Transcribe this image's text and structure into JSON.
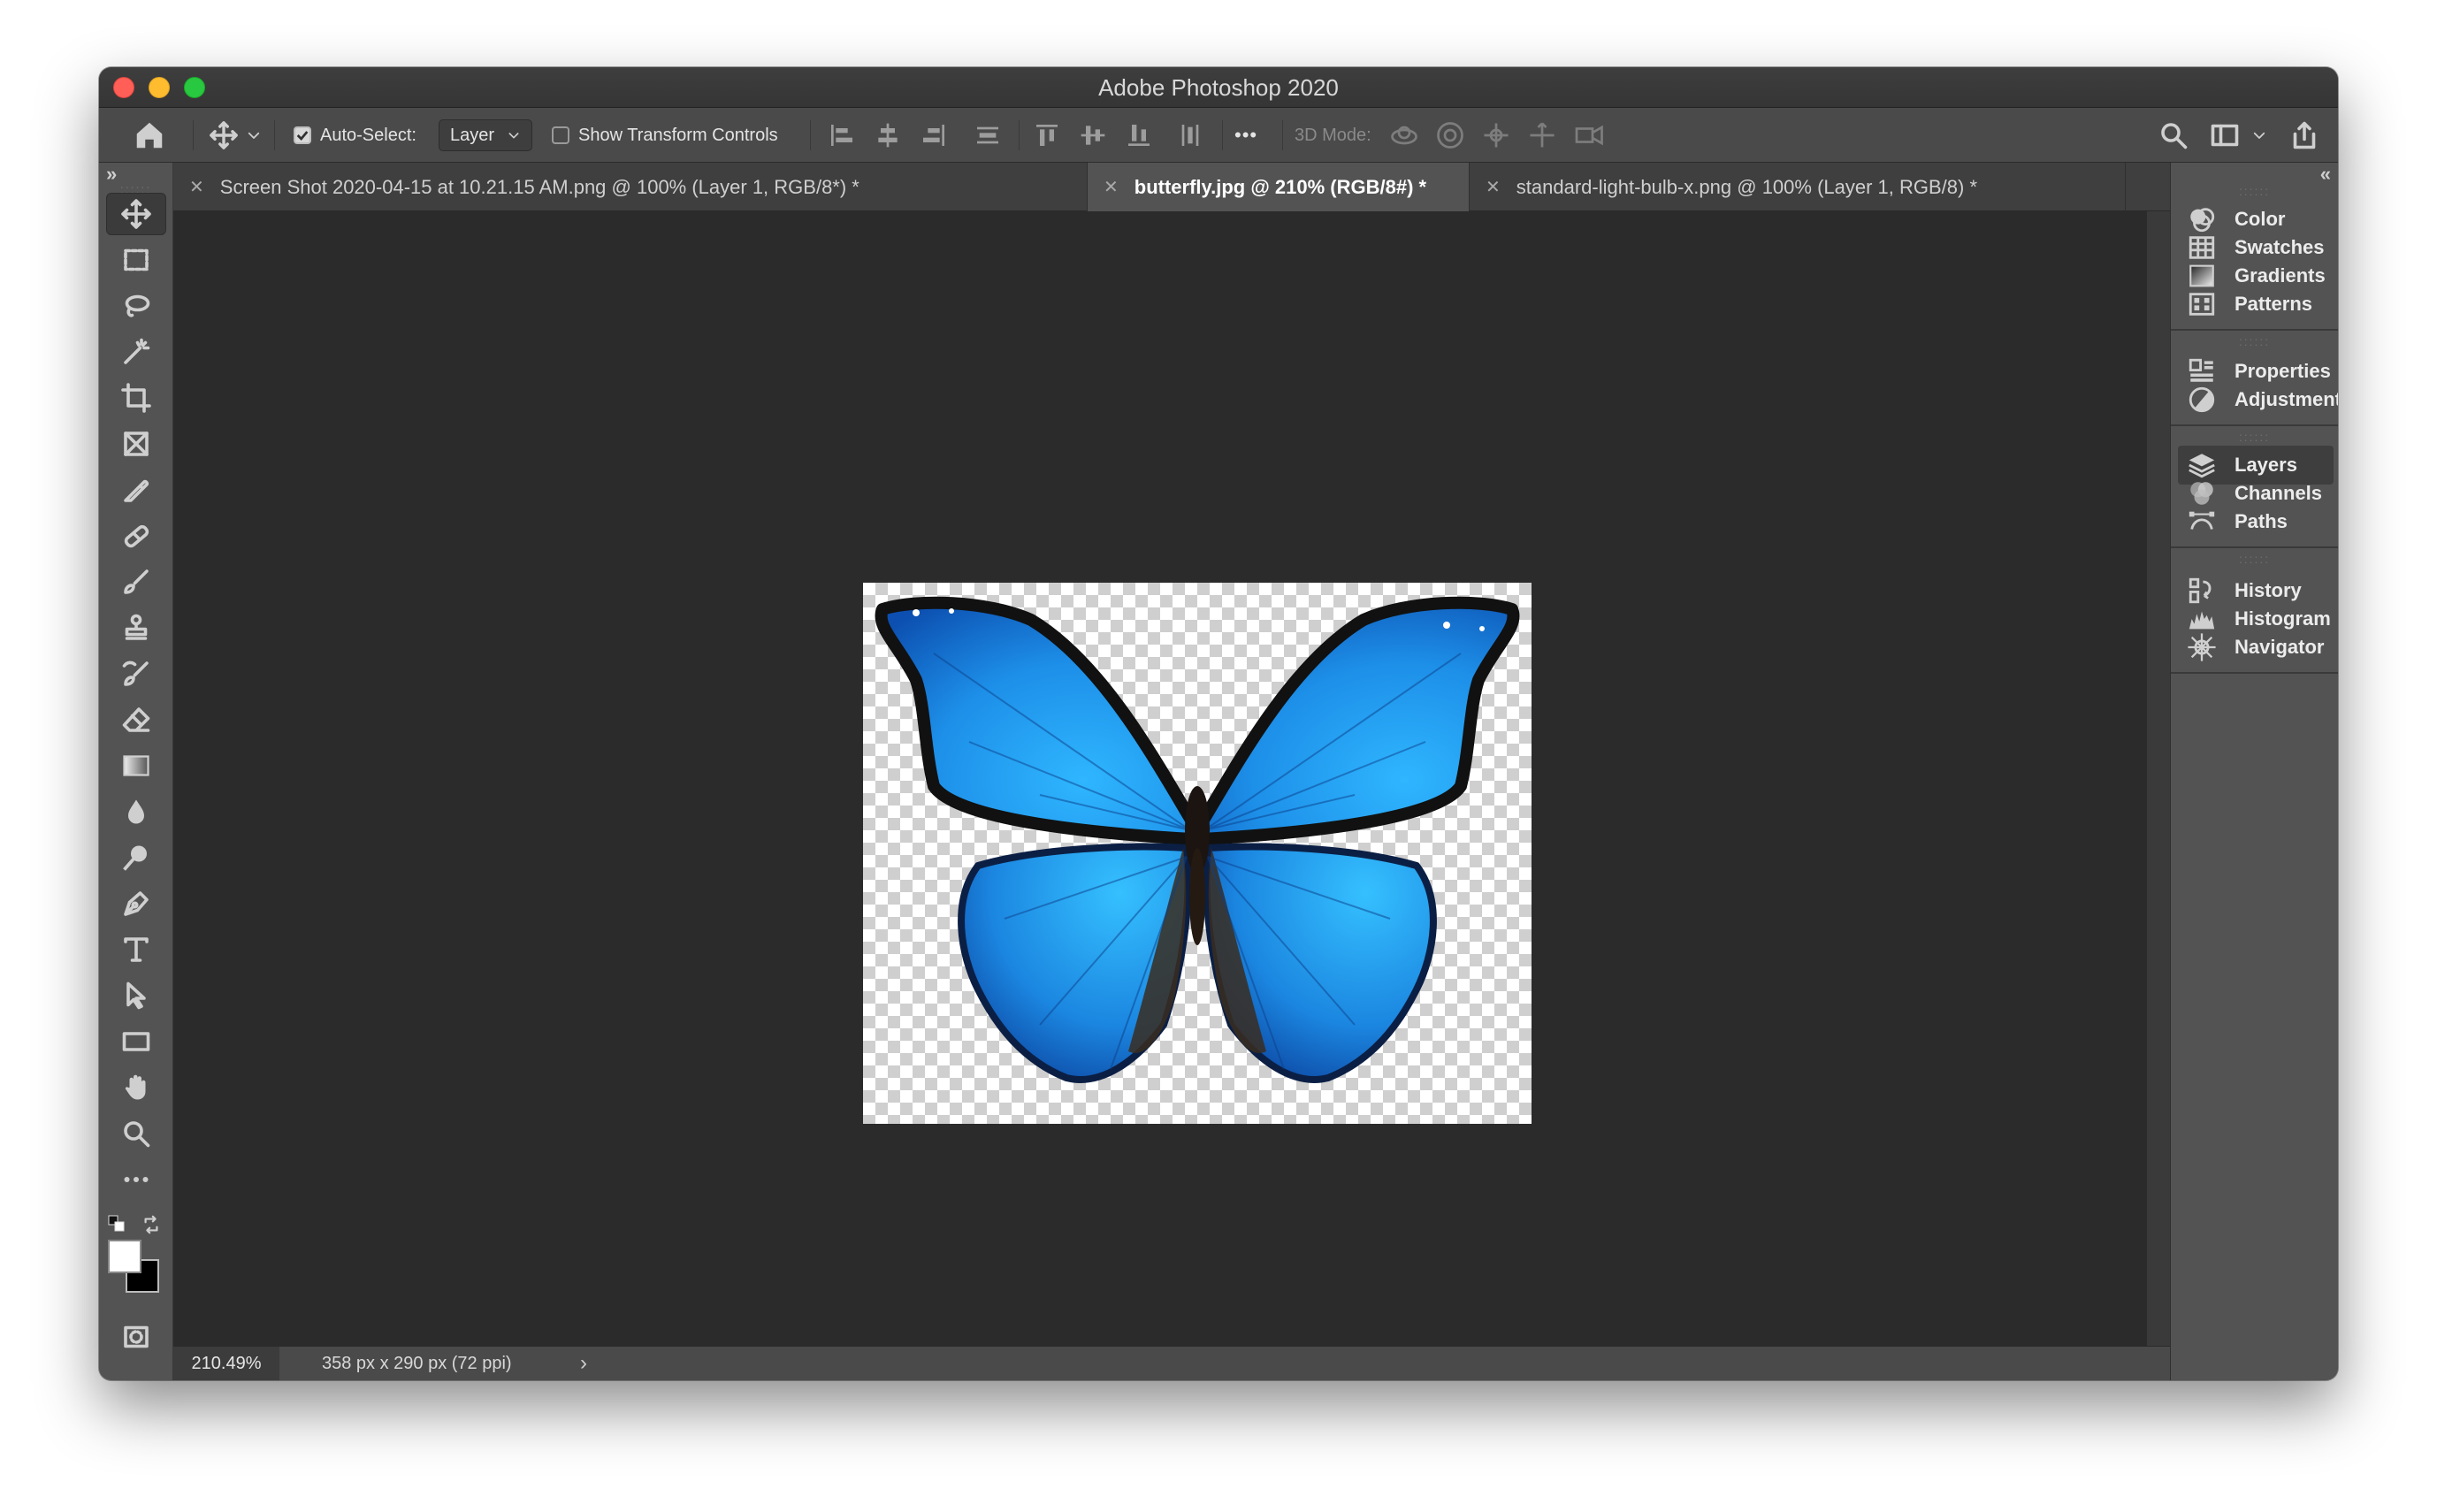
{
  "window": {
    "title": "Adobe Photoshop 2020"
  },
  "options_bar": {
    "auto_select_label": "Auto-Select:",
    "auto_select_checked": true,
    "auto_select_target": "Layer",
    "show_transform_label": "Show Transform Controls",
    "show_transform_checked": false,
    "mode_3d_label": "3D Mode:",
    "more_label": "•••"
  },
  "tabs": [
    {
      "label": "Screen Shot 2020-04-15 at 10.21.15 AM.png @ 100% (Layer 1, RGB/8*) *",
      "active": false
    },
    {
      "label": "butterfly.jpg @ 210% (RGB/8#) *",
      "active": true
    },
    {
      "label": "standard-light-bulb-x.png @ 100% (Layer 1, RGB/8) *",
      "active": false
    }
  ],
  "tools": [
    "move-tool",
    "marquee-tool",
    "lasso-tool",
    "magic-wand-tool",
    "crop-tool",
    "frame-tool",
    "eyedropper-tool",
    "healing-brush-tool",
    "brush-tool",
    "clone-stamp-tool",
    "history-brush-tool",
    "eraser-tool",
    "gradient-tool",
    "blur-tool",
    "dodge-tool",
    "pen-tool",
    "type-tool",
    "path-selection-tool",
    "rectangle-tool",
    "hand-tool",
    "zoom-tool",
    "edit-toolbar"
  ],
  "colors": {
    "foreground": "#ffffff",
    "background": "#000000"
  },
  "status": {
    "zoom": "210.49%",
    "doc_info": "358 px x 290 px (72 ppi)"
  },
  "panels": {
    "group1": [
      {
        "label": "Color",
        "icon": "color-icon"
      },
      {
        "label": "Swatches",
        "icon": "swatches-icon"
      },
      {
        "label": "Gradients",
        "icon": "gradients-icon"
      },
      {
        "label": "Patterns",
        "icon": "patterns-icon"
      }
    ],
    "group2": [
      {
        "label": "Properties",
        "icon": "properties-icon"
      },
      {
        "label": "Adjustments",
        "icon": "adjustments-icon"
      }
    ],
    "group3": [
      {
        "label": "Layers",
        "icon": "layers-icon",
        "active": true
      },
      {
        "label": "Channels",
        "icon": "channels-icon"
      },
      {
        "label": "Paths",
        "icon": "paths-icon"
      }
    ],
    "group4": [
      {
        "label": "History",
        "icon": "history-icon"
      },
      {
        "label": "Histogram",
        "icon": "histogram-icon"
      },
      {
        "label": "Navigator",
        "icon": "navigator-icon"
      }
    ]
  },
  "canvas": {
    "subject": "butterfly",
    "wing_color": "#1e9bf0"
  }
}
